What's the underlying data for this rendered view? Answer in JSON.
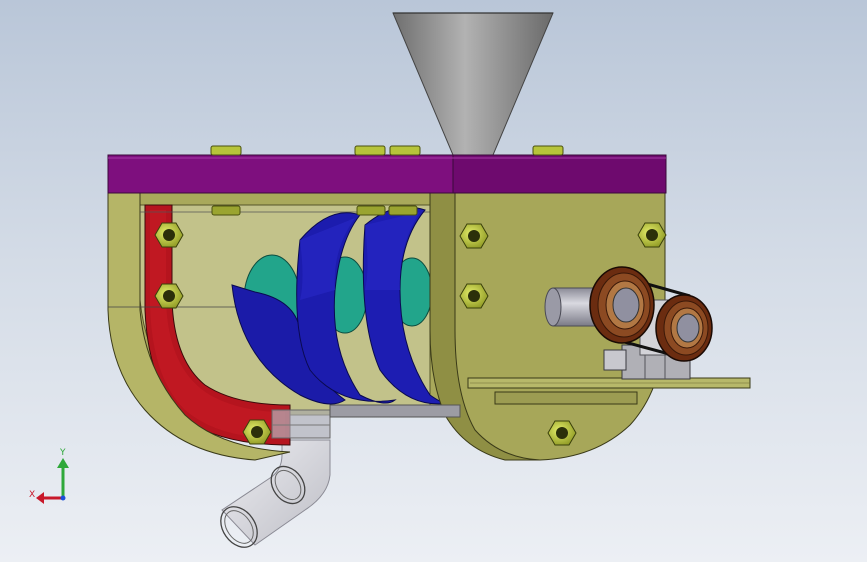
{
  "viewport": {
    "background_top": "#b9c6d8",
    "background_bottom": "#eceff4"
  },
  "triad": {
    "y_label": "Y",
    "x_label": "X",
    "y_color": "#2fa83a",
    "x_color": "#c8182a",
    "z_color": "#1d4fd8"
  },
  "colors": {
    "frame_olive": "#a8a85a",
    "frame_olive_dark": "#7f7f3c",
    "top_plate": "#7d0f7d",
    "red_band": "#b4141e",
    "screw_blue": "#1a1aa6",
    "screw_core": "#21a38a",
    "hopper": "#8a8a8a",
    "bolt": "#b6c43a",
    "pulley_brown": "#7a3a1a",
    "pipe": "#cfcfd4"
  }
}
